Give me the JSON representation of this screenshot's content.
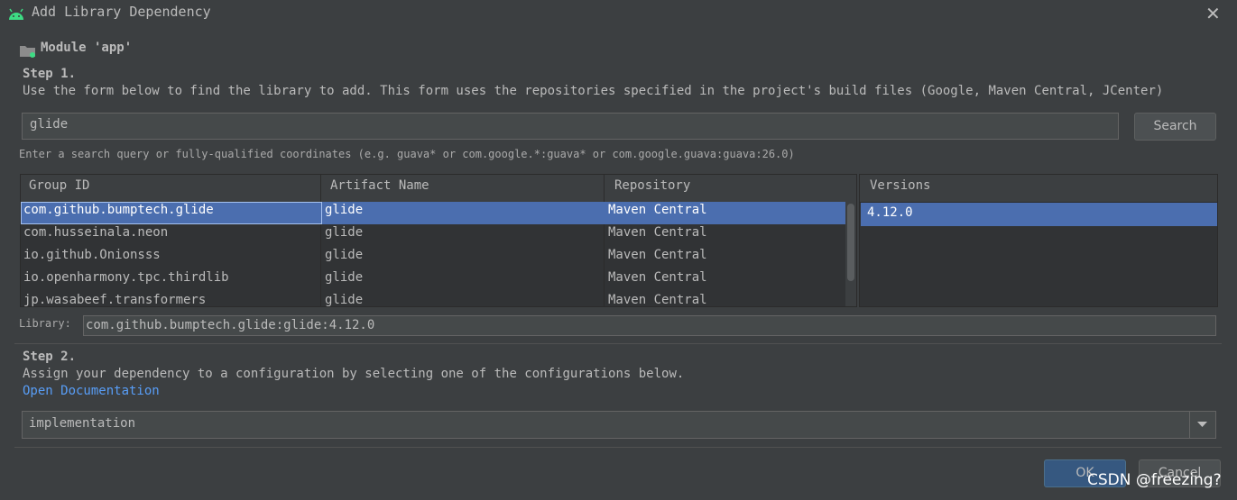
{
  "window": {
    "title": "Add Library Dependency",
    "close_icon": "close-icon"
  },
  "module": {
    "label": "Module 'app'",
    "icon": "folder-module-icon"
  },
  "step1": {
    "title": "Step 1.",
    "description": "Use the form below to find the library to add. This form uses the repositories specified in the project's build files (Google, Maven Central, JCenter)"
  },
  "search": {
    "value": "glide",
    "button_label": "Search",
    "hint": "Enter a search query or fully-qualified coordinates (e.g. guava* or com.google.*:guava* or com.google.guava:guava:26.0)"
  },
  "results": {
    "columns": [
      "Group ID",
      "Artifact Name",
      "Repository"
    ],
    "rows": [
      {
        "group": "com.github.bumptech.glide",
        "artifact": "glide",
        "repository": "Maven Central",
        "selected": true
      },
      {
        "group": "com.husseinala.neon",
        "artifact": "glide",
        "repository": "Maven Central",
        "selected": false
      },
      {
        "group": "io.github.Onionsss",
        "artifact": "glide",
        "repository": "Maven Central",
        "selected": false
      },
      {
        "group": "io.openharmony.tpc.thirdlib",
        "artifact": "glide",
        "repository": "Maven Central",
        "selected": false
      },
      {
        "group": "jp.wasabeef.transformers",
        "artifact": "glide",
        "repository": "Maven Central",
        "selected": false
      }
    ]
  },
  "versions": {
    "header": "Versions",
    "items": [
      "4.12.0"
    ]
  },
  "library": {
    "label": "Library:",
    "value": "com.github.bumptech.glide:glide:4.12.0"
  },
  "step2": {
    "title": "Step 2.",
    "description": "Assign your dependency to a configuration by selecting one of the configurations below.",
    "link": "Open Documentation",
    "configuration": "implementation"
  },
  "buttons": {
    "ok": "OK",
    "cancel": "Cancel"
  },
  "watermark": "CSDN @freezing?",
  "colors": {
    "background": "#3c3f41",
    "selection": "#4b6eaf",
    "link": "#589df6",
    "android_green": "#3ddc84"
  }
}
